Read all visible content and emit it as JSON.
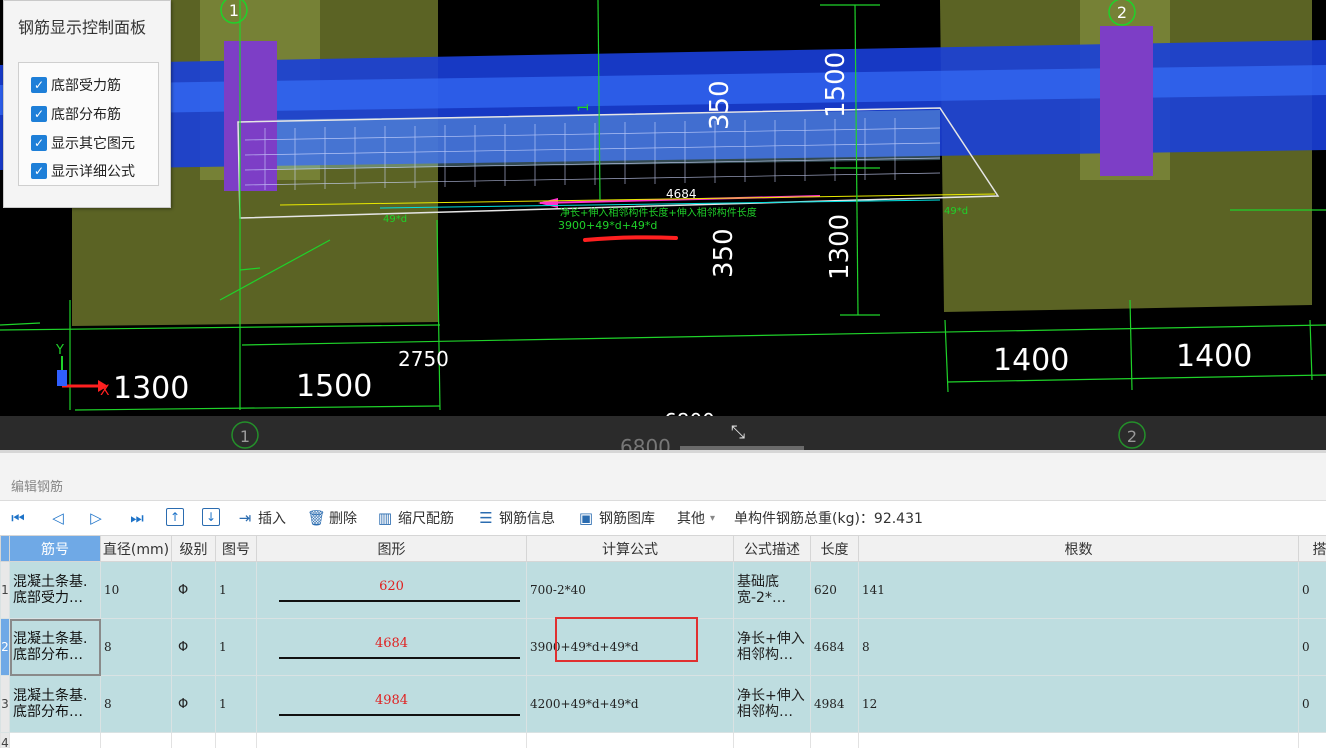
{
  "control_panel": {
    "title": "钢筋显示控制面板",
    "options": [
      {
        "label": "底部受力筋",
        "checked": true
      },
      {
        "label": "底部分布筋",
        "checked": true
      },
      {
        "label": "显示其它图元",
        "checked": true
      },
      {
        "label": "显示详细公式",
        "checked": true
      }
    ]
  },
  "viewport": {
    "axis_labels": [
      "1",
      "2"
    ],
    "dims_vertical": [
      "350",
      "1500",
      "350",
      "1300"
    ],
    "dims_bottom": [
      "1300",
      "1500",
      "2750",
      "1400",
      "1400",
      "6800",
      "6800"
    ],
    "rebar_length_label": "4684",
    "rebar_formula_label": "3900+49*d+49*d",
    "rebar_note_label": "净长+伸入相邻构件长度+伸入相邻构件长度",
    "lap_label_left": "49*d",
    "lap_label_right": "49*d",
    "small_marker": "1",
    "axis_x": "X",
    "axis_y": "Y",
    "colors": {
      "beam": "#1f3fe0",
      "footing": "#6f7a2a",
      "column": "#7f3fc6",
      "dim": "#1fd22a",
      "rebar_pink": "#ff33cc",
      "highlight": "#e03030"
    }
  },
  "editor": {
    "title": "编辑钢筋",
    "toolbar": {
      "insert": "插入",
      "delete": "删除",
      "scale_rebar": "缩尺配筋",
      "rebar_info": "钢筋信息",
      "rebar_library": "钢筋图库",
      "other": "其他",
      "total_weight": "单构件钢筋总重(kg)：92.431"
    },
    "columns": [
      "筋号",
      "直径(mm)",
      "级别",
      "图号",
      "图形",
      "计算公式",
      "公式描述",
      "长度",
      "根数",
      "搭"
    ],
    "rows": [
      {
        "index": "1",
        "name": "混凝土条基.底部受力…",
        "diameter": "10",
        "grade": "Φ",
        "fig": "1",
        "shape_len": "620",
        "formula": "700-2*40",
        "desc": "基础底宽-2*…",
        "length": "620",
        "count": "141",
        "lap": "0"
      },
      {
        "index": "2",
        "name": "混凝土条基.底部分布…",
        "diameter": "8",
        "grade": "Φ",
        "fig": "1",
        "shape_len": "4684",
        "formula": "3900+49*d+49*d",
        "desc": "净长+伸入相邻构…",
        "length": "4684",
        "count": "8",
        "lap": "0"
      },
      {
        "index": "3",
        "name": "混凝土条基.底部分布…",
        "diameter": "8",
        "grade": "Φ",
        "fig": "1",
        "shape_len": "4984",
        "formula": "4200+49*d+49*d",
        "desc": "净长+伸入相邻构…",
        "length": "4984",
        "count": "12",
        "lap": "0"
      }
    ],
    "empty_row_index": "4"
  }
}
